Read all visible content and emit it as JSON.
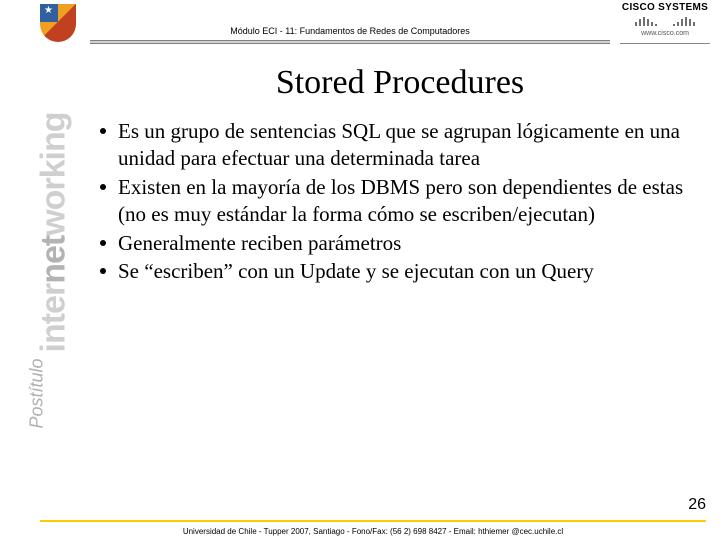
{
  "header": {
    "module_title": "Módulo ECI - 11: Fundamentos de Redes de Computadores",
    "cisco_brand": "CISCO SYSTEMS",
    "cisco_url": "www.cisco.com"
  },
  "sidebar": {
    "postitulo": "Postítulo",
    "word1a": "inter",
    "word1b": "net",
    "word1c": "working"
  },
  "slide": {
    "title": "Stored Procedures",
    "bullets": [
      "Es un grupo de sentencias SQL que se agrupan lógicamente en una unidad para efectuar una determinada tarea",
      "Existen en la mayoría de los DBMS pero son dependientes de estas (no es muy estándar la forma cómo se escriben/ejecutan)",
      "Generalmente reciben parámetros",
      "Se “escriben” con un Update y se ejecutan con un Query"
    ],
    "page_number": "26"
  },
  "footer": {
    "text": "Universidad de Chile - Tupper 2007, Santiago - Fono/Fax: (56 2) 698 8427 - Email: hthiemer @cec.uchile.cl"
  }
}
